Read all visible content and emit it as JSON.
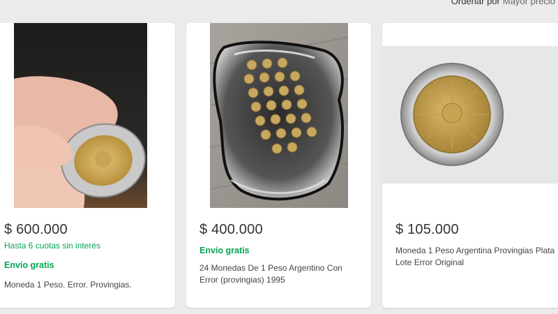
{
  "sort": {
    "label": "Ordenar por",
    "value": "Mayor precio"
  },
  "listings": [
    {
      "image_icon": "hand-holding-coin-photo",
      "price": "$ 600.000",
      "installments": "Hasta 6 cuotas sin interés",
      "shipping": "Envío gratis",
      "title": "Moneda 1 Peso. Error. Provingias."
    },
    {
      "image_icon": "coins-on-tray-photo",
      "price": "$ 400.000",
      "shipping": "Envío gratis",
      "title": "24 Monedas De 1 Peso Argentino Con Error (provingias) 1995"
    },
    {
      "image_icon": "single-coin-photo",
      "price": "$ 105.000",
      "title": "Moneda 1 Peso Argentina Provingias Plata Lote Error Original"
    }
  ],
  "colors": {
    "accent_green": "#00a650",
    "background": "#ebebeb"
  }
}
